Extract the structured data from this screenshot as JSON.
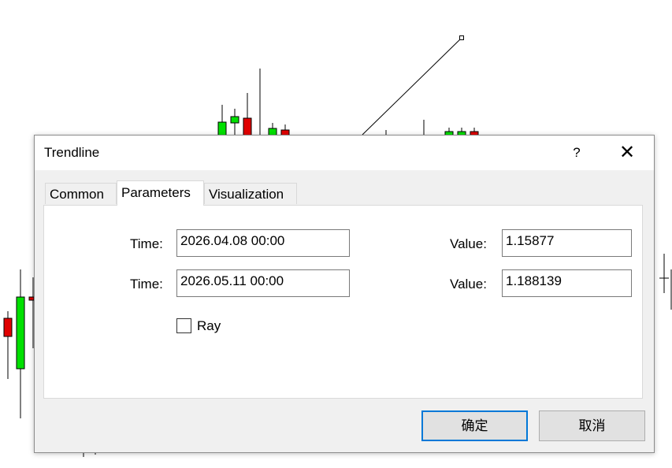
{
  "dialog": {
    "title": "Trendline",
    "help_label": "?",
    "close_label": "✕"
  },
  "tabs": [
    {
      "label": "Common"
    },
    {
      "label": "Parameters",
      "active": true
    },
    {
      "label": "Visualization"
    }
  ],
  "parameters": {
    "time_label": "Time:",
    "value_label": "Value:",
    "point1": {
      "time": "2026.04.08 00:00",
      "value": "1.15877"
    },
    "point2": {
      "time": "2026.05.11 00:00",
      "value": "1.188139"
    },
    "ray": {
      "label": "Ray",
      "checked": false
    }
  },
  "buttons": {
    "ok": "确定",
    "cancel": "取消"
  },
  "colors": {
    "bull_candle": "#00e000",
    "bear_candle": "#e00000",
    "accent": "#0078d7"
  }
}
